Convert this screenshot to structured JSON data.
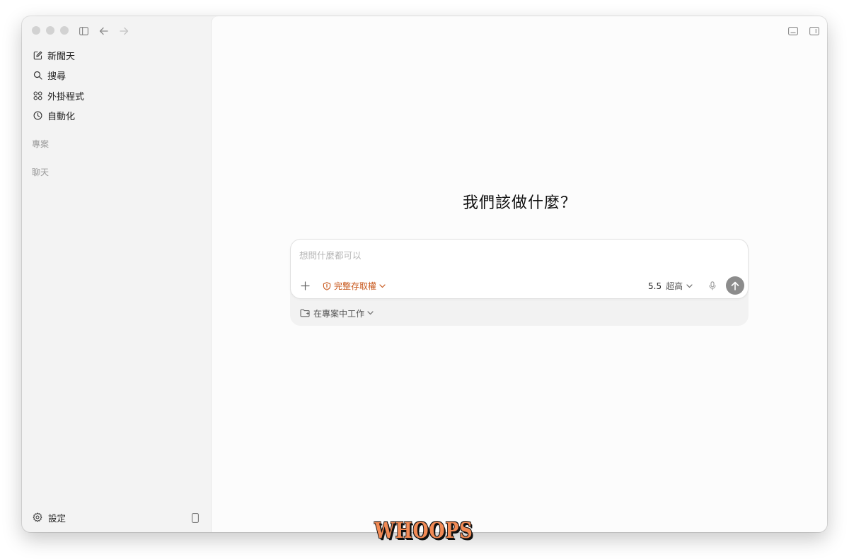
{
  "sidebar": {
    "nav_items": [
      {
        "label": "新聞天",
        "icon": "edit-icon"
      },
      {
        "label": "搜尋",
        "icon": "search-icon"
      },
      {
        "label": "外掛程式",
        "icon": "plugins-icon"
      },
      {
        "label": "自動化",
        "icon": "clock-icon"
      }
    ],
    "projects_label": "專案",
    "chats_label": "聊天",
    "settings_label": "設定"
  },
  "main": {
    "heading": "我們該做什麼？",
    "composer": {
      "placeholder": "想問什麼都可以",
      "access_label": "完整存取權",
      "model_version": "5.5",
      "reasoning_level": "超高",
      "project_label": "在專案中工作"
    }
  },
  "watermark": {
    "text": "WHOOPS"
  },
  "colors": {
    "accent": "#c7561a",
    "send_button": "#8c8c8c",
    "sidebar_bg": "#f3f3f3",
    "main_bg": "#fcfcfc"
  }
}
